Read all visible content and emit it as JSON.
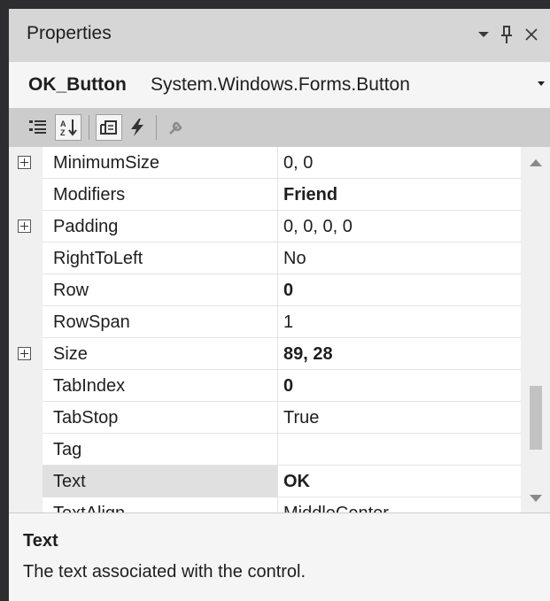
{
  "window": {
    "title": "Properties",
    "controls": {
      "dropdown_icon": "chevron-down-icon",
      "pin_icon": "pin-icon",
      "close_icon": "close-icon"
    }
  },
  "object_selector": {
    "name": "OK_Button",
    "type": "System.Windows.Forms.Button"
  },
  "toolbar": {
    "tools": [
      {
        "name": "categorized",
        "icon": "categorized-icon",
        "active": false
      },
      {
        "name": "alphabetical",
        "icon": "alphabetical-icon",
        "active": true
      },
      {
        "name": "properties",
        "icon": "properties-icon",
        "active": true
      },
      {
        "name": "events",
        "icon": "events-icon",
        "active": false
      },
      {
        "name": "property-pages",
        "icon": "wrench-icon",
        "active": false
      }
    ]
  },
  "grid": {
    "rows": [
      {
        "name": "MinimumSize",
        "value": "0, 0",
        "expandable": true,
        "bold": false
      },
      {
        "name": "Modifiers",
        "value": "Friend",
        "expandable": false,
        "bold": true
      },
      {
        "name": "Padding",
        "value": "0, 0, 0, 0",
        "expandable": true,
        "bold": false
      },
      {
        "name": "RightToLeft",
        "value": "No",
        "expandable": false,
        "bold": false
      },
      {
        "name": "Row",
        "value": "0",
        "expandable": false,
        "bold": true
      },
      {
        "name": "RowSpan",
        "value": "1",
        "expandable": false,
        "bold": false
      },
      {
        "name": "Size",
        "value": "89, 28",
        "expandable": true,
        "bold": true
      },
      {
        "name": "TabIndex",
        "value": "0",
        "expandable": false,
        "bold": true
      },
      {
        "name": "TabStop",
        "value": "True",
        "expandable": false,
        "bold": false
      },
      {
        "name": "Tag",
        "value": "",
        "expandable": false,
        "bold": false
      },
      {
        "name": "Text",
        "value": "OK",
        "expandable": false,
        "bold": true,
        "selected": true
      },
      {
        "name": "TextAlign",
        "value": "MiddleCenter",
        "expandable": false,
        "bold": false
      }
    ]
  },
  "description": {
    "title": "Text",
    "text": "The text associated with the control."
  }
}
